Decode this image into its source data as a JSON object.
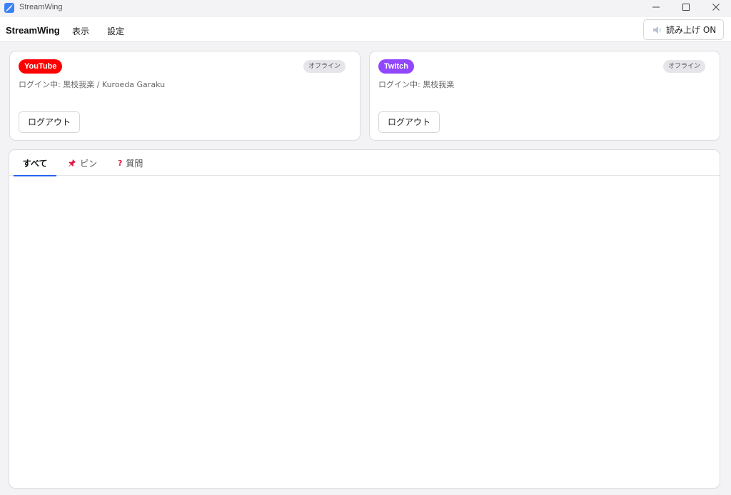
{
  "window": {
    "title": "StreamWing",
    "icon": "app-logo-icon"
  },
  "window_controls": {
    "minimize": "minimize-icon",
    "maximize": "maximize-icon",
    "close": "close-icon"
  },
  "menubar": {
    "brand": "StreamWing",
    "items": [
      {
        "label": "表示"
      },
      {
        "label": "設定"
      }
    ],
    "tts_button": {
      "label": "読み上げ ON",
      "icon": "speaker-icon"
    }
  },
  "accounts": {
    "youtube": {
      "platform": "YouTube",
      "color": "#ff0000",
      "status": "オフライン",
      "login_text": "ログイン中: 黒枝我楽 / Kuroeda Garaku",
      "logout_label": "ログアウト"
    },
    "twitch": {
      "platform": "Twitch",
      "color": "#9146ff",
      "status": "オフライン",
      "login_text": "ログイン中: 黒枝我楽",
      "logout_label": "ログアウト"
    }
  },
  "tabs": [
    {
      "label": "すべて",
      "active": true
    },
    {
      "label": "ピン",
      "icon": "pushpin-icon",
      "icon_color": "#e11d48"
    },
    {
      "label": "質問",
      "icon": "question-mark-icon",
      "icon_color": "#e11d48"
    }
  ],
  "colors": {
    "accent": "#2563eb",
    "background": "#f3f3f5"
  }
}
